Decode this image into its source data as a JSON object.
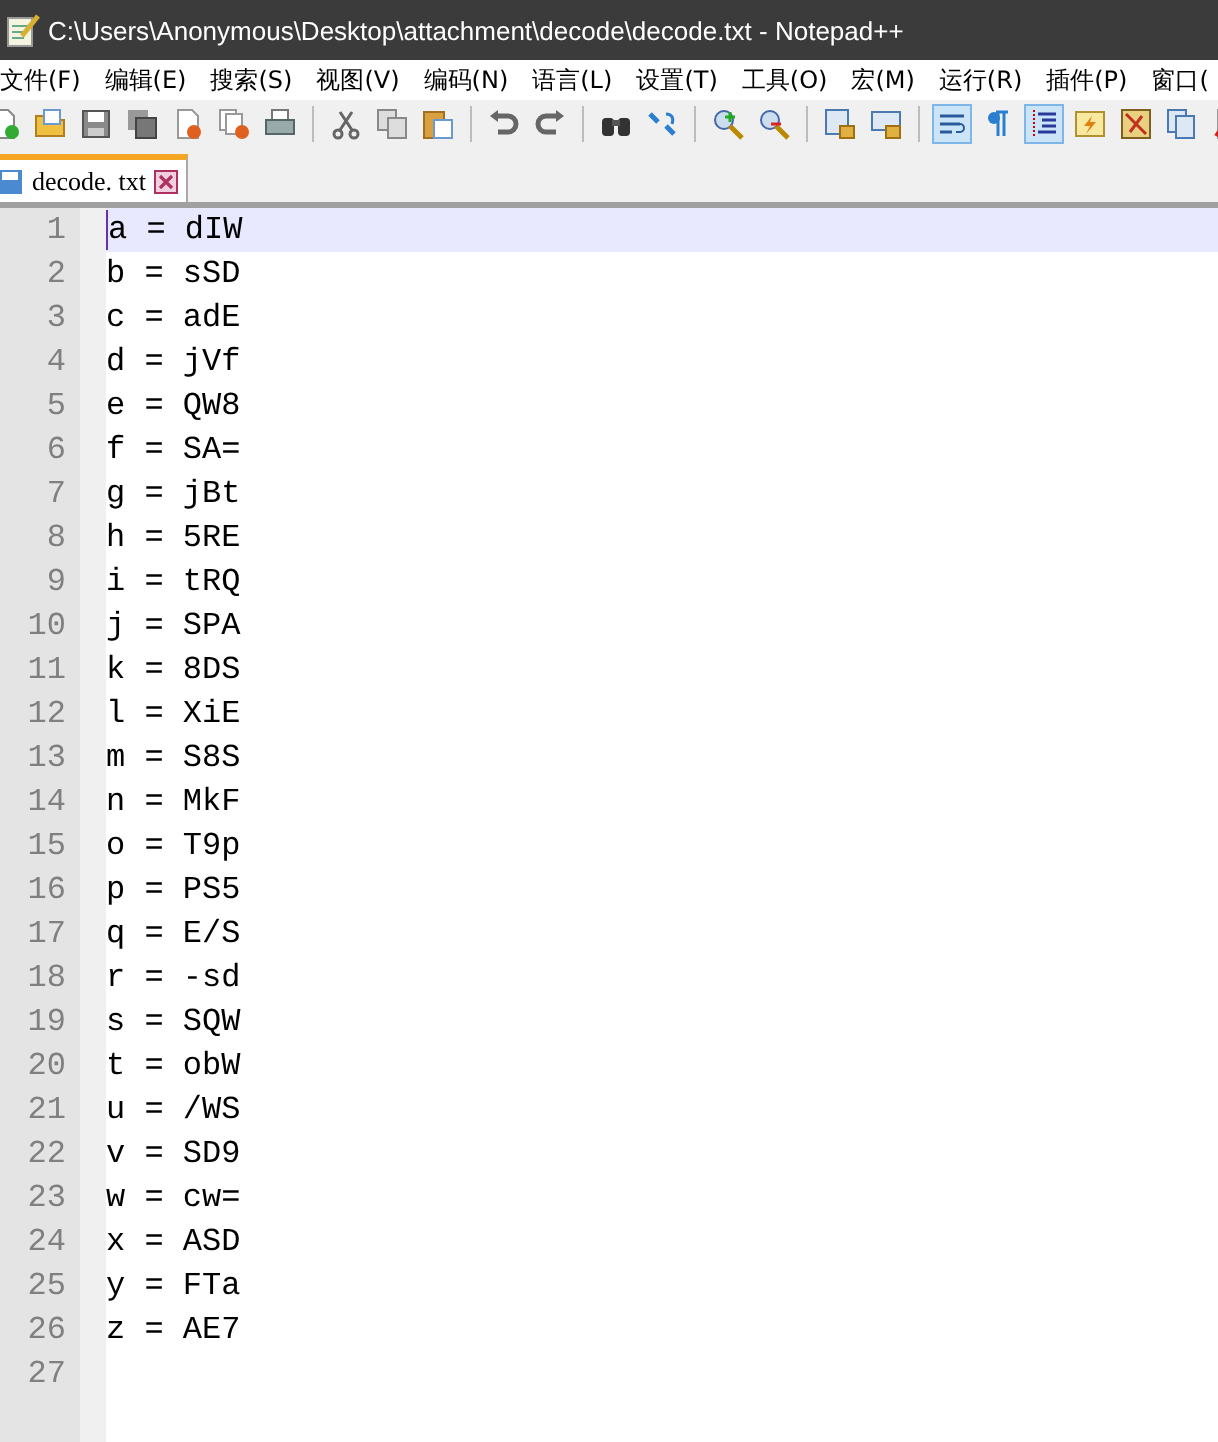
{
  "window": {
    "title": "C:\\Users\\Anonymous\\Desktop\\attachment\\decode\\decode.txt - Notepad++"
  },
  "menu": [
    "文件(F)",
    "编辑(E)",
    "搜索(S)",
    "视图(V)",
    "编码(N)",
    "语言(L)",
    "设置(T)",
    "工具(O)",
    "宏(M)",
    "运行(R)",
    "插件(P)",
    "窗口("
  ],
  "toolbar": [
    {
      "kind": "new",
      "on": false
    },
    {
      "kind": "open",
      "on": false
    },
    {
      "kind": "save",
      "on": false
    },
    {
      "kind": "save-all",
      "on": false
    },
    {
      "kind": "close",
      "on": false
    },
    {
      "kind": "close-all",
      "on": false
    },
    {
      "kind": "print",
      "on": false
    },
    {
      "kind": "sep"
    },
    {
      "kind": "cut",
      "on": false
    },
    {
      "kind": "copy",
      "on": false
    },
    {
      "kind": "paste",
      "on": false
    },
    {
      "kind": "sep"
    },
    {
      "kind": "undo",
      "on": false
    },
    {
      "kind": "redo",
      "on": false
    },
    {
      "kind": "sep"
    },
    {
      "kind": "find",
      "on": false
    },
    {
      "kind": "replace",
      "on": false
    },
    {
      "kind": "sep"
    },
    {
      "kind": "zoom-in",
      "on": false
    },
    {
      "kind": "zoom-out",
      "on": false
    },
    {
      "kind": "sep"
    },
    {
      "kind": "sync-v",
      "on": false
    },
    {
      "kind": "sync-h",
      "on": false
    },
    {
      "kind": "sep"
    },
    {
      "kind": "wrap",
      "on": true
    },
    {
      "kind": "pilcrow",
      "on": false
    },
    {
      "kind": "indent",
      "on": true
    },
    {
      "kind": "lang",
      "on": false
    },
    {
      "kind": "map",
      "on": false
    },
    {
      "kind": "docs",
      "on": false
    },
    {
      "kind": "func",
      "on": false
    }
  ],
  "tabs": [
    {
      "label": "decode. txt",
      "selected": true
    }
  ],
  "lines": [
    {
      "number": "1",
      "text": "a = dIW",
      "selected": true
    },
    {
      "number": "2",
      "text": "b = sSD",
      "selected": false
    },
    {
      "number": "3",
      "text": "c = adE",
      "selected": false
    },
    {
      "number": "4",
      "text": "d = jVf",
      "selected": false
    },
    {
      "number": "5",
      "text": "e = QW8",
      "selected": false
    },
    {
      "number": "6",
      "text": "f = SA=",
      "selected": false
    },
    {
      "number": "7",
      "text": "g = jBt",
      "selected": false
    },
    {
      "number": "8",
      "text": "h = 5RE",
      "selected": false
    },
    {
      "number": "9",
      "text": "i = tRQ",
      "selected": false
    },
    {
      "number": "10",
      "text": "j = SPA",
      "selected": false
    },
    {
      "number": "11",
      "text": "k = 8DS",
      "selected": false
    },
    {
      "number": "12",
      "text": "l = XiE",
      "selected": false
    },
    {
      "number": "13",
      "text": "m = S8S",
      "selected": false
    },
    {
      "number": "14",
      "text": "n = MkF",
      "selected": false
    },
    {
      "number": "15",
      "text": "o = T9p",
      "selected": false
    },
    {
      "number": "16",
      "text": "p = PS5",
      "selected": false
    },
    {
      "number": "17",
      "text": "q = E/S",
      "selected": false
    },
    {
      "number": "18",
      "text": "r = -sd",
      "selected": false
    },
    {
      "number": "19",
      "text": "s = SQW",
      "selected": false
    },
    {
      "number": "20",
      "text": "t = obW",
      "selected": false
    },
    {
      "number": "21",
      "text": "u = /WS",
      "selected": false
    },
    {
      "number": "22",
      "text": "v = SD9",
      "selected": false
    },
    {
      "number": "23",
      "text": "w = cw=",
      "selected": false
    },
    {
      "number": "24",
      "text": "x = ASD",
      "selected": false
    },
    {
      "number": "25",
      "text": "y = FTa",
      "selected": false
    },
    {
      "number": "26",
      "text": "z = AE7",
      "selected": false
    },
    {
      "number": "27",
      "selected": false
    }
  ]
}
